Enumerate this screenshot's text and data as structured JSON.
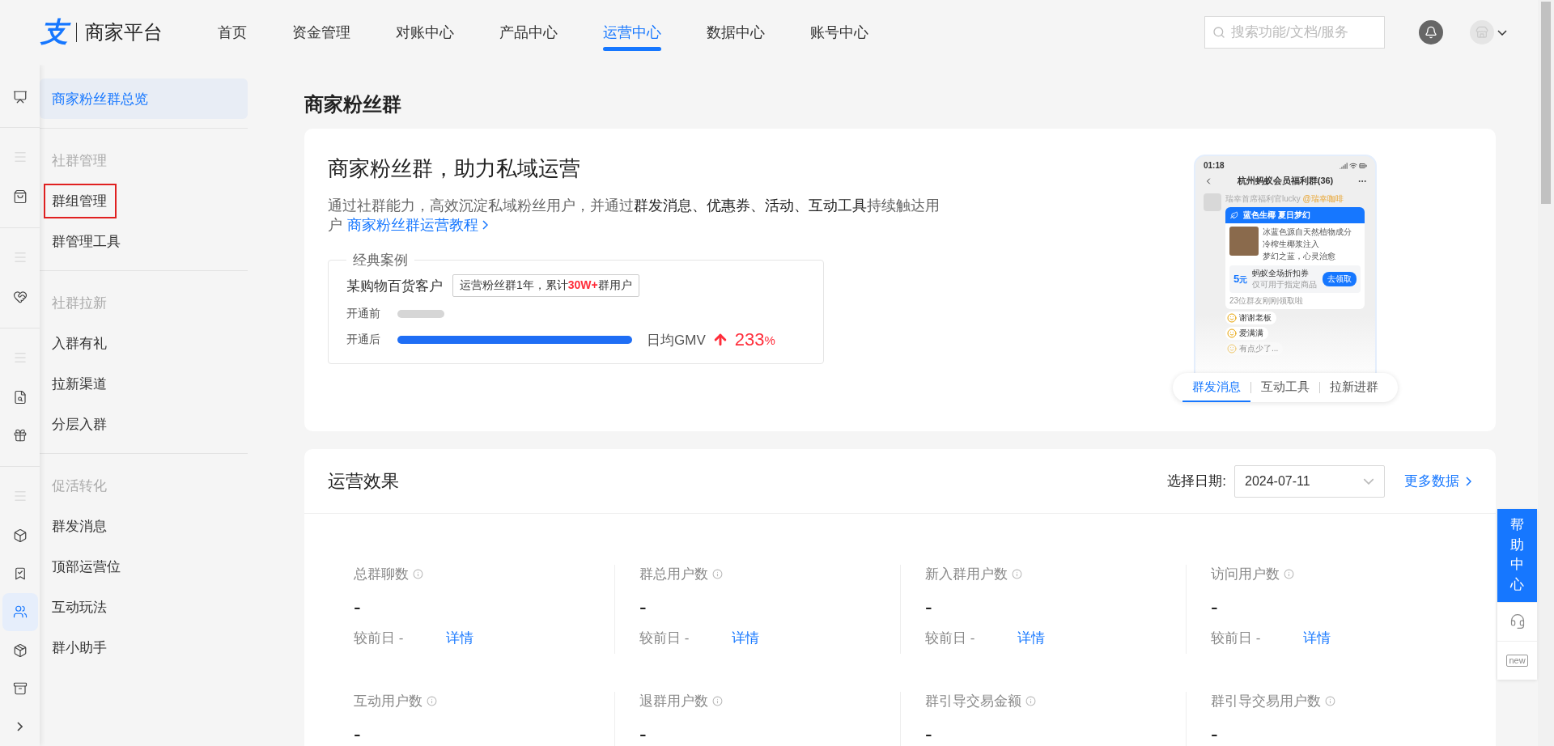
{
  "header": {
    "logo_mark": "支",
    "logo_text": "商家平台",
    "nav": [
      {
        "label": "首页",
        "selected": false
      },
      {
        "label": "资金管理",
        "selected": false
      },
      {
        "label": "对账中心",
        "selected": false
      },
      {
        "label": "产品中心",
        "selected": false
      },
      {
        "label": "运营中心",
        "selected": true
      },
      {
        "label": "数据中心",
        "selected": false
      },
      {
        "label": "账号中心",
        "selected": false
      }
    ],
    "search": {
      "placeholder": "搜索功能/文档/服务"
    }
  },
  "rail": {
    "items": [
      {
        "kind": "icon",
        "selected": false
      },
      {
        "kind": "divider"
      },
      {
        "kind": "handle"
      },
      {
        "kind": "icon",
        "selected": false
      },
      {
        "kind": "divider"
      },
      {
        "kind": "handle"
      },
      {
        "kind": "icon",
        "selected": false
      },
      {
        "kind": "divider"
      },
      {
        "kind": "handle"
      },
      {
        "kind": "icon",
        "selected": false
      },
      {
        "kind": "icon",
        "selected": false
      },
      {
        "kind": "divider"
      },
      {
        "kind": "handle"
      },
      {
        "kind": "icon",
        "selected": false
      },
      {
        "kind": "icon",
        "selected": false
      },
      {
        "kind": "icon",
        "selected": true
      },
      {
        "kind": "icon",
        "selected": false
      },
      {
        "kind": "icon",
        "selected": false
      },
      {
        "kind": "icon",
        "selected": false
      }
    ]
  },
  "sidebar": {
    "items": [
      {
        "kind": "item",
        "label": "商家粉丝群总览",
        "selected": true,
        "highlighted": false
      },
      {
        "kind": "divider"
      },
      {
        "kind": "heading",
        "label": "社群管理"
      },
      {
        "kind": "item",
        "label": "群组管理",
        "selected": false,
        "highlighted": true
      },
      {
        "kind": "item",
        "label": "群管理工具",
        "selected": false,
        "highlighted": false
      },
      {
        "kind": "divider"
      },
      {
        "kind": "heading",
        "label": "社群拉新"
      },
      {
        "kind": "item",
        "label": "入群有礼",
        "selected": false,
        "highlighted": false
      },
      {
        "kind": "item",
        "label": "拉新渠道",
        "selected": false,
        "highlighted": false
      },
      {
        "kind": "item",
        "label": "分层入群",
        "selected": false,
        "highlighted": false
      },
      {
        "kind": "divider"
      },
      {
        "kind": "heading",
        "label": "促活转化"
      },
      {
        "kind": "item",
        "label": "群发消息",
        "selected": false,
        "highlighted": false
      },
      {
        "kind": "item",
        "label": "顶部运营位",
        "selected": false,
        "highlighted": false
      },
      {
        "kind": "item",
        "label": "互动玩法",
        "selected": false,
        "highlighted": false
      },
      {
        "kind": "item",
        "label": "群小助手",
        "selected": false,
        "highlighted": false
      }
    ]
  },
  "page_title": "商家粉丝群",
  "hero": {
    "title": "商家粉丝群，助力私域运营",
    "description": "通过社群能力，高效沉淀私域粉丝用户，并通过**群发消息、优惠券、活动、互动工具**持续触达用户",
    "link": "商家粉丝群运营教程",
    "case": {
      "legend": "经典案例",
      "client": "某购物百货客户",
      "tag": "运营粉丝群1年，累计**30W+**群用户",
      "bars": [
        {
          "label": "开通前",
          "level": 0.2,
          "active": false
        },
        {
          "label": "开通后",
          "level": 1,
          "active": true
        }
      ],
      "metric_label": "日均GMV",
      "metric_value": "233",
      "metric_unit": "%"
    },
    "phone": {
      "time": "01:18",
      "chat_title": "杭州蚂蚁会员福利群(36)",
      "sender": "瑞幸首席福利官lucky",
      "mention": "@瑞幸咖啡",
      "card_title": "蓝色生椰 夏日梦幻",
      "features": [
        "冰蓝色源自天然植物成分",
        "冷榨生椰浆注入",
        "梦幻之蓝，心灵治愈"
      ],
      "coupon_amount": "5",
      "coupon_unit": "元",
      "coupon_title": "蚂蚁全场折扣券",
      "coupon_note": "仅可用于指定商品",
      "coupon_button": "去领取",
      "claimed": "23位群友刚刚领取啦",
      "replies": [
        {
          "text": "谢谢老板",
          "faded": false
        },
        {
          "text": "爱满满",
          "faded": false
        },
        {
          "text": "有点少了...",
          "faded": true
        }
      ]
    },
    "tabs": [
      {
        "label": "群发消息",
        "selected": true
      },
      {
        "label": "互动工具",
        "selected": false
      },
      {
        "label": "拉新进群",
        "selected": false
      }
    ]
  },
  "effects": {
    "title": "运营效果",
    "date_label": "选择日期:",
    "date_value": "2024-07-11",
    "more": "更多数据",
    "metrics": [
      {
        "label": "总群聊数",
        "value": "-",
        "compare": "较前日 -",
        "detail": "详情"
      },
      {
        "label": "群总用户数",
        "value": "-",
        "compare": "较前日 -",
        "detail": "详情"
      },
      {
        "label": "新入群用户数",
        "value": "-",
        "compare": "较前日 -",
        "detail": "详情"
      },
      {
        "label": "访问用户数",
        "value": "-",
        "compare": "较前日 -",
        "detail": "详情"
      },
      {
        "label": "互动用户数",
        "value": "-"
      },
      {
        "label": "退群用户数",
        "value": "-"
      },
      {
        "label": "群引导交易金额",
        "value": "-"
      },
      {
        "label": "群引导交易用户数",
        "value": "-"
      }
    ]
  },
  "help": {
    "label": "帮助中心",
    "new_badge": "new"
  }
}
